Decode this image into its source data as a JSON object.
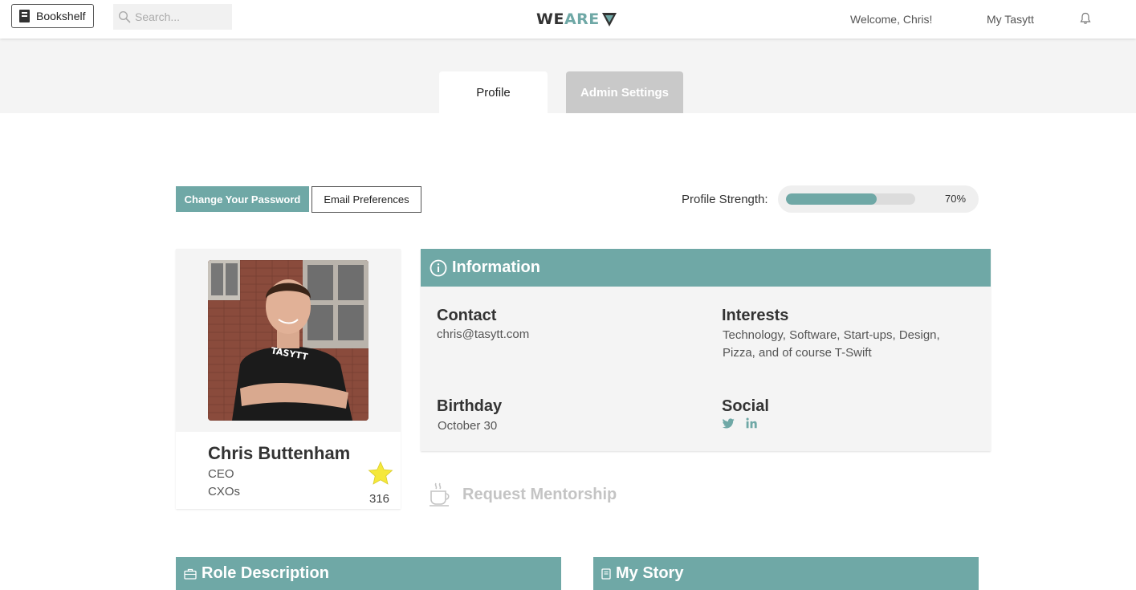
{
  "topbar": {
    "bookshelf_label": "Bookshelf",
    "search_placeholder": "Search...",
    "logo_we": "WE",
    "logo_are": "ARE",
    "welcome": "Welcome, Chris!",
    "my_link": "My Tasytt"
  },
  "tabs": [
    {
      "label": "Profile",
      "active": true
    },
    {
      "label": "Admin Settings",
      "active": false
    }
  ],
  "actions": {
    "change_password": "Change Your Password",
    "email_prefs": "Email Preferences",
    "strength_label": "Profile Strength:",
    "strength_pct_text": "70%",
    "strength_value": 0.7
  },
  "profile": {
    "name": "Chris Buttenham",
    "title": "CEO",
    "department": "CXOs",
    "points": "316",
    "shirt_text": "TASYTT"
  },
  "info": {
    "title": "Information",
    "contact_h": "Contact",
    "contact_v": "chris@tasytt.com",
    "interests_h": "Interests",
    "interests_line1": "Technology, Software, Start-ups, Design,",
    "interests_line2": "Pizza, and of course T-Swift",
    "birthday_h": "Birthday",
    "birthday_v": "October 30",
    "social_h": "Social",
    "social_icons": [
      "twitter-icon",
      "linkedin-icon"
    ]
  },
  "mentorship": {
    "label": "Request Mentorship"
  },
  "sections": {
    "role": "Role Description",
    "story": "My Story"
  },
  "colors": {
    "accent": "#6fa8a6",
    "tab_inactive": "#c9c9c9",
    "muted": "#c4c4c4",
    "star": "#f5e83a"
  }
}
